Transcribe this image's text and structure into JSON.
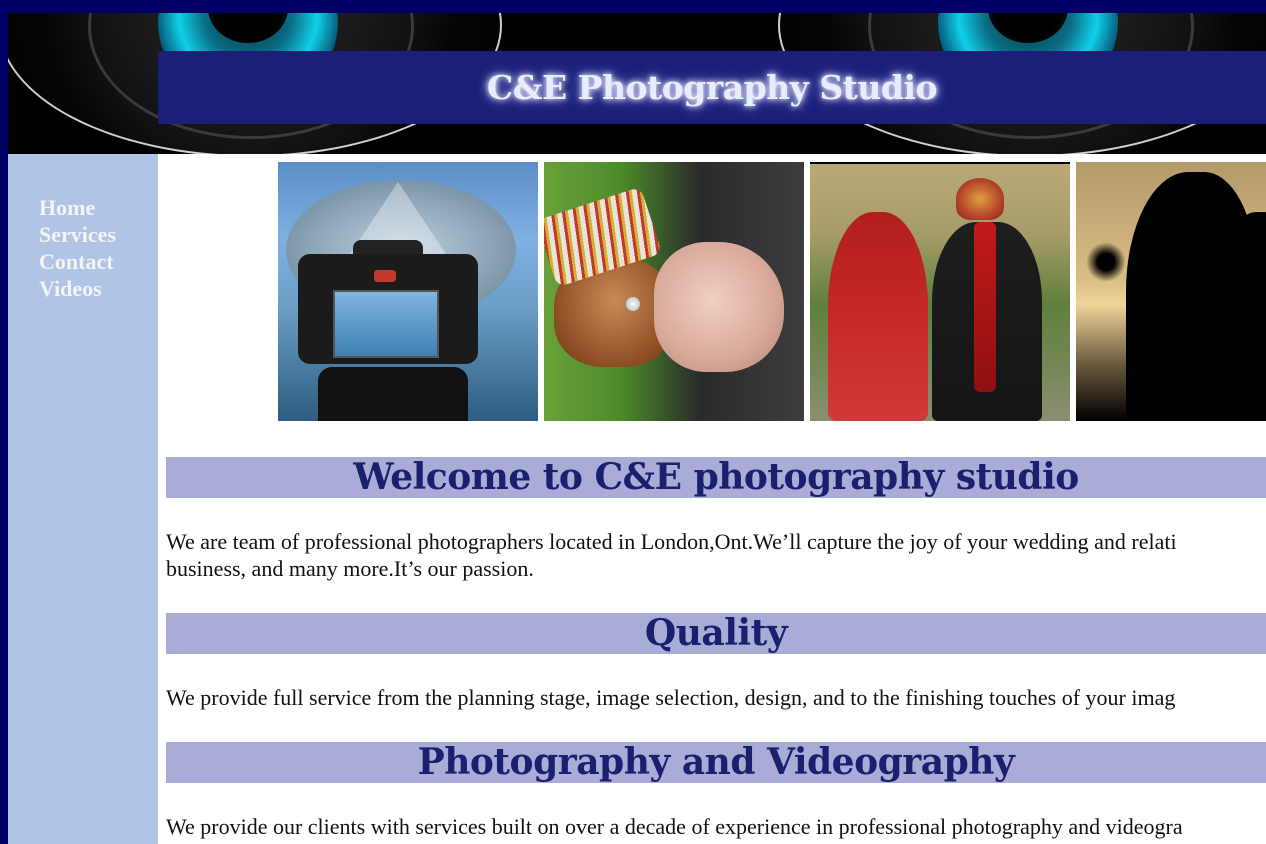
{
  "header": {
    "title": "C&E Photography Studio"
  },
  "sidebar": {
    "items": [
      {
        "label": "Home"
      },
      {
        "label": "Services"
      },
      {
        "label": "Contact"
      },
      {
        "label": "Videos"
      }
    ]
  },
  "gallery": {
    "photos": [
      {
        "icon": "camera-on-tripod-photo"
      },
      {
        "icon": "wedding-hands-ring-photo"
      },
      {
        "icon": "bride-and-groom-photo"
      },
      {
        "icon": "couple-silhouette-photo"
      }
    ]
  },
  "sections": [
    {
      "heading": "Welcome to C&E photography studio",
      "lines": [
        "We are team of professional photographers located in London,Ont.We’ll capture the joy of your wedding and relati",
        "business, and many more.It’s our passion."
      ]
    },
    {
      "heading": "Quality",
      "lines": [
        "We provide full service from the planning stage, image selection, design, and to the finishing touches of your imag"
      ]
    },
    {
      "heading": "Photography and Videography",
      "lines": [
        "We provide our clients with services built on over a decade of experience in professional photography and videogra"
      ]
    }
  ],
  "colors": {
    "page_border": "#000066",
    "title_bar": "#1a1f7a",
    "sidebar": "#b0c4e6",
    "heading_bg": "#a9acd6",
    "heading_text": "#1a1f6e"
  }
}
